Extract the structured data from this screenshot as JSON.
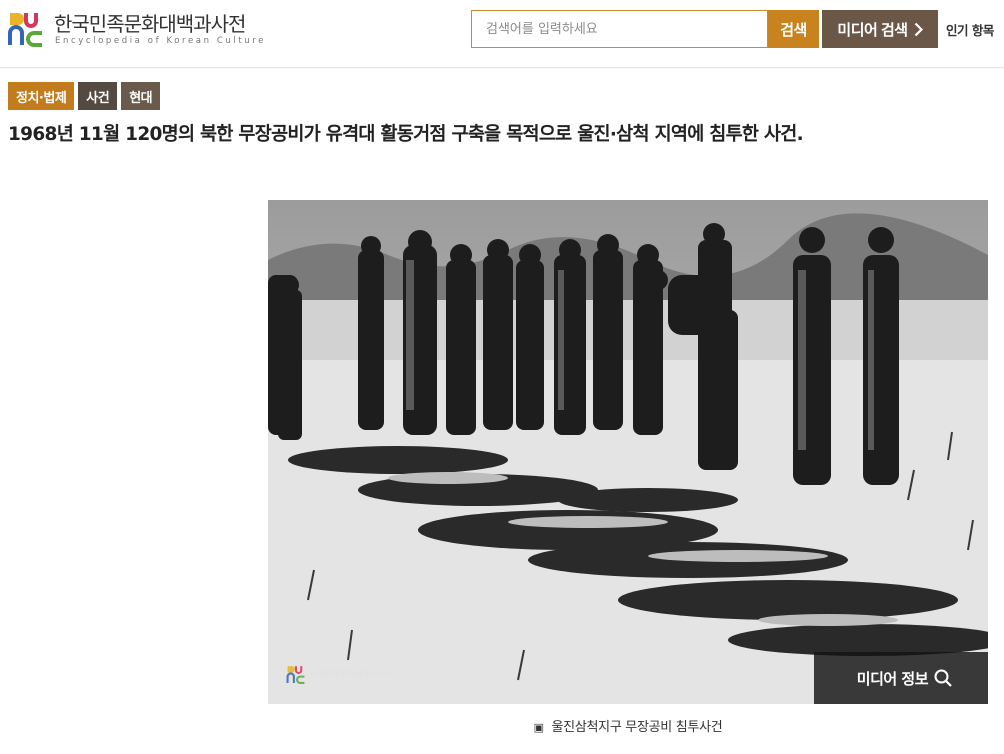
{
  "header": {
    "site_title": "한국민족문화대백과사전",
    "site_subtitle": "Encyclopedia of Korean Culture",
    "search_placeholder": "검색어를 입력하세요",
    "search_button": "검색",
    "media_search_button": "미디어 검색",
    "popular_label": "인기 항목"
  },
  "tags": [
    "정치·법제",
    "사건",
    "현대"
  ],
  "summary": "1968년 11월 120명의 북한 무장공비가 유격대 활동거점 구축을 목적으로 울진·삼척 지역에 침투한 사건.",
  "media": {
    "info_button": "미디어 정보",
    "caption": "울진삼척지구 무장공비 침투사건",
    "watermark_text": "한국민족문화대백과사전"
  },
  "colors": {
    "accent": "#c8831f",
    "media_button": "#6a5748",
    "tag_dark": "#554a42"
  },
  "icons": {
    "search": "magnifier-icon",
    "chevron": "chevron-right-icon",
    "logo": "eokc-logo-icon",
    "caption": "photo-icon"
  }
}
